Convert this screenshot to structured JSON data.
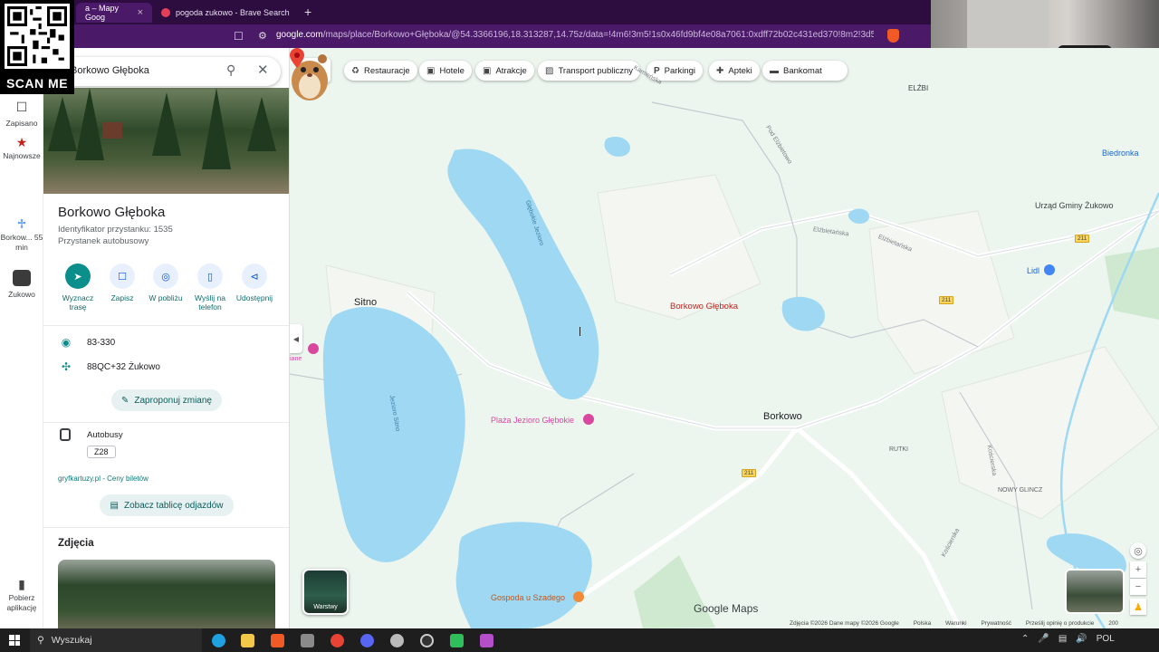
{
  "browser": {
    "tabs": [
      {
        "title": "a – Mapy Goog",
        "active": true
      },
      {
        "title": "pogoda zukowo - Brave Search",
        "active": false
      }
    ],
    "url_host": "google.com",
    "url_rest": "/maps/place/Borkowo+Głęboka/@54.3366196,18.313287,14.75z/data=!4m6!3m5!1s0x46fd9bf4e08a7061:0xdff72b02c431ed370!8m2!3d54.337692!..."
  },
  "qr_overlay": {
    "caption": "SCAN ME"
  },
  "rail": {
    "items": [
      {
        "label": "Zapisano",
        "icon": "bookmark-icon"
      },
      {
        "label": "Najnowsze",
        "icon": "recent-icon"
      },
      {
        "label": "Borkow... 55 min",
        "icon": "walking-icon"
      },
      {
        "label": "Żukowo",
        "icon": "place-thumb-icon"
      },
      {
        "label": "Pobierz aplikację",
        "icon": "phone-icon"
      }
    ]
  },
  "panel": {
    "search_value": "Borkowo Głęboka",
    "title": "Borkowo Głęboka",
    "subtitle1": "Identyfikator przystanku: 1535",
    "subtitle2": "Przystanek autobusowy",
    "actions": [
      {
        "label": "Wyznacz trasę",
        "icon": "directions-icon",
        "primary": true
      },
      {
        "label": "Zapisz",
        "icon": "bookmark-icon",
        "primary": false
      },
      {
        "label": "W pobliżu",
        "icon": "nearby-icon",
        "primary": false
      },
      {
        "label": "Wyślij na telefon",
        "icon": "send-to-phone-icon",
        "primary": false
      },
      {
        "label": "Udostępnij",
        "icon": "share-icon",
        "primary": false
      }
    ],
    "postal_code": "83-330",
    "plus_code": "88QC+32 Żukowo",
    "suggest_edit": "Zaproponuj zmianę",
    "buses_label": "Autobusy",
    "bus_route": "Z28",
    "tickets_link": "gryfkartuzy.pl - Ceny biletów",
    "departures_button": "Zobacz tablicę odjazdów",
    "photos_heading": "Zdjęcia"
  },
  "map": {
    "chips": [
      "Restauracje",
      "Hotele",
      "Atrakcje",
      "Transport publiczny",
      "Parkingi",
      "Apteki",
      "Bankomat"
    ],
    "place_pin_label": "Borkowo Głęboka",
    "towns": [
      "Sitno",
      "Borkowo",
      "ELŹBI",
      "RUTKI",
      "NOWY GLINCZ"
    ],
    "lakes": [
      "Głębokie Jezioro",
      "Jezioro Sitno"
    ],
    "pois": {
      "beach": "Plaża Jezioro Głębokie",
      "restaurant": "Gospoda u Szadego",
      "biedronka": "Biedronka",
      "lidl": "Lidl",
      "office": "Urząd Gminy Żukowo",
      "left_edge": "iane"
    },
    "roads": [
      "Pod Elżbietowo",
      "Elżbietańska",
      "Kościerska",
      "Kamieńska",
      "Pod Elżbietowo"
    ],
    "road_badges": [
      "211",
      "211",
      "211"
    ],
    "layers_label": "Warstwy",
    "brand": "Google Maps",
    "attribution": [
      "Zdjęcia ©2026 Dane mapy ©2026 Google",
      "Polska",
      "Warunki",
      "Prywatność",
      "Prześlij opinię o produkcie",
      "200"
    ]
  },
  "taskbar": {
    "search_placeholder": "Wyszukaj",
    "language": "POL"
  },
  "colors": {
    "water": "#9fd8f3",
    "land": "#ecf6ee",
    "accent": "#0b8f8c",
    "pin": "#ea4335",
    "browser": "#4a1967"
  }
}
